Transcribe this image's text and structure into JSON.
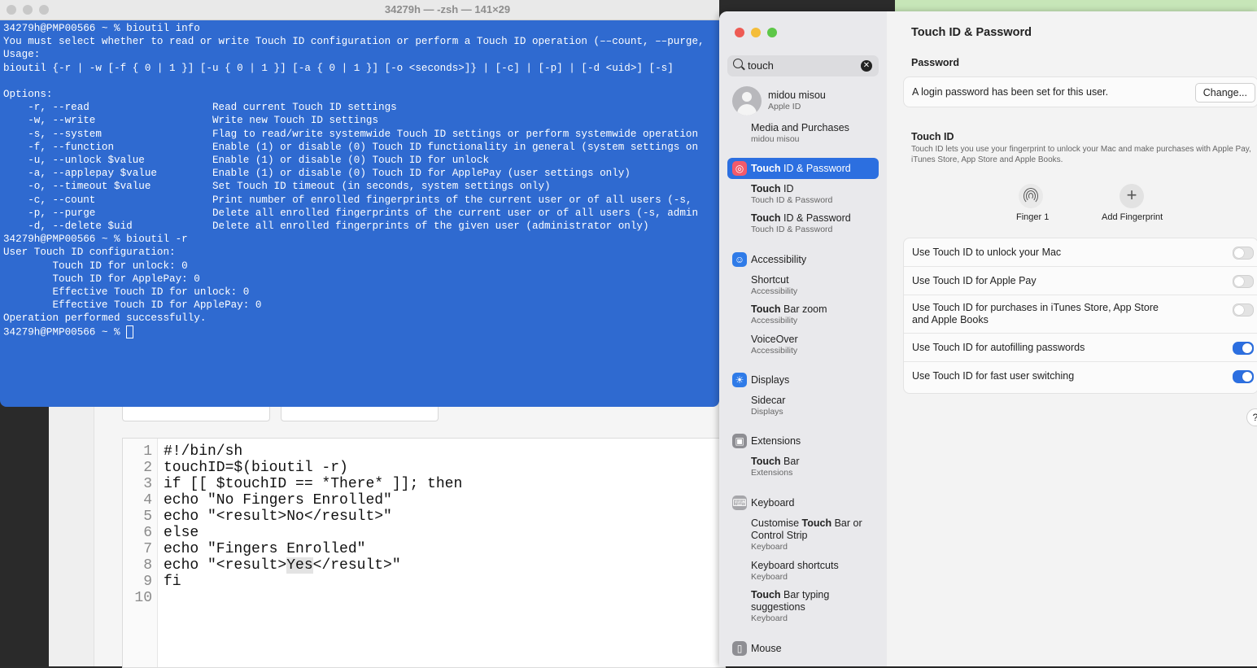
{
  "terminal": {
    "title": "34279h — -zsh — 141×29",
    "lines": [
      "34279h@PMP00566 ~ % bioutil info",
      "You must select whether to read or write Touch ID configuration or perform a Touch ID operation (––count, ––purge,",
      "Usage:",
      "bioutil {-r | -w [-f { 0 | 1 }] [-u { 0 | 1 }] [-a { 0 | 1 }] [-o <seconds>]} | [-c] | [-p] | [-d <uid>] [-s]",
      "",
      "Options:",
      "    -r, --read                    Read current Touch ID settings",
      "    -w, --write                   Write new Touch ID settings",
      "    -s, --system                  Flag to read/write systemwide Touch ID settings or perform systemwide operation",
      "    -f, --function                Enable (1) or disable (0) Touch ID functionality in general (system settings on",
      "    -u, --unlock $value           Enable (1) or disable (0) Touch ID for unlock",
      "    -a, --applepay $value         Enable (1) or disable (0) Touch ID for ApplePay (user settings only)",
      "    -o, --timeout $value          Set Touch ID timeout (in seconds, system settings only)",
      "    -c, --count                   Print number of enrolled fingerprints of the current user or of all users (-s,",
      "    -p, --purge                   Delete all enrolled fingerprints of the current user or of all users (-s, admin",
      "    -d, --delete $uid             Delete all enrolled fingerprints of the given user (administrator only)",
      "34279h@PMP00566 ~ % bioutil -r",
      "User Touch ID configuration:",
      "        Touch ID for unlock: 0",
      "        Touch ID for ApplePay: 0",
      "        Effective Touch ID for unlock: 0",
      "        Effective Touch ID for ApplePay: 0",
      "Operation performed successfully.",
      "34279h@PMP00566 ~ % "
    ]
  },
  "editor": {
    "code": [
      {
        "n": "1",
        "t": "#!/bin/sh"
      },
      {
        "n": "2",
        "t": "touchID=$(bioutil -r)"
      },
      {
        "n": "3",
        "t": "if [[ $touchID == *There* ]]; then"
      },
      {
        "n": "4",
        "t": "echo \"No Fingers Enrolled\""
      },
      {
        "n": "5",
        "t": "echo \"<result>No</result>\""
      },
      {
        "n": "6",
        "t": "else"
      },
      {
        "n": "7",
        "t": "echo \"Fingers Enrolled\""
      },
      {
        "n": "8a",
        "t": "echo \"<result>"
      },
      {
        "n": "8b",
        "t": "Yes"
      },
      {
        "n": "8c",
        "t": "</result>\""
      },
      {
        "n": "9",
        "t": "fi"
      },
      {
        "n": "10",
        "t": ""
      }
    ],
    "line8": "8"
  },
  "settings": {
    "search": {
      "value": "touch"
    },
    "account": {
      "name": "midou misou",
      "sub": "Apple ID"
    },
    "media": {
      "label": "Media and Purchases",
      "sub": "midou misou"
    },
    "selected": {
      "bold": "Touch",
      "rest": " ID & Password"
    },
    "results": [
      {
        "bold": "Touch",
        "rest": " ID",
        "sub": "Touch ID & Password"
      },
      {
        "bold": "Touch",
        "rest": " ID & Password",
        "sub": "Touch ID & Password"
      }
    ],
    "cat_accessibility": "Accessibility",
    "acc_items": [
      {
        "pre": "Shortcut",
        "bold": "",
        "rest": "",
        "sub": "Accessibility"
      },
      {
        "pre": "",
        "bold": "Touch",
        "rest": " Bar zoom",
        "sub": "Accessibility"
      },
      {
        "pre": "VoiceOver",
        "bold": "",
        "rest": "",
        "sub": "Accessibility"
      }
    ],
    "cat_displays": "Displays",
    "sidecar": {
      "label": "Sidecar",
      "sub": "Displays"
    },
    "cat_extensions": "Extensions",
    "touchbar": {
      "bold": "Touch",
      "rest": " Bar",
      "sub": "Extensions"
    },
    "cat_keyboard": "Keyboard",
    "kb_custom": {
      "pre": "Customise ",
      "bold": "Touch",
      "rest": " Bar or",
      "line2": "Control Strip",
      "sub": "Keyboard"
    },
    "kb_shortcuts": {
      "label": "Keyboard shortcuts",
      "sub": "Keyboard"
    },
    "kb_typing": {
      "bold": "Touch",
      "rest": " Bar typing",
      "line2": "suggestions",
      "sub": "Keyboard"
    },
    "cat_mouse": "Mouse",
    "content": {
      "title": "Touch ID & Password",
      "password_heading": "Password",
      "password_text": "A login password has been set for this user.",
      "change_button": "Change...",
      "touchid_heading": "Touch ID",
      "touchid_desc": "Touch ID lets you use your fingerprint to unlock your Mac and make purchases with Apple Pay, iTunes Store, App Store and Apple Books.",
      "finger1": "Finger 1",
      "add_fingerprint": "Add Fingerprint",
      "toggles": [
        {
          "label": "Use Touch ID to unlock your Mac",
          "on": false
        },
        {
          "label": "Use Touch ID for Apple Pay",
          "on": false
        },
        {
          "label": "Use Touch ID for purchases in iTunes Store, App Store",
          "label2": "and Apple Books",
          "on": false
        },
        {
          "label": "Use Touch ID for autofilling passwords",
          "on": true
        },
        {
          "label": "Use Touch ID for fast user switching",
          "on": true
        }
      ],
      "help": "?"
    }
  }
}
